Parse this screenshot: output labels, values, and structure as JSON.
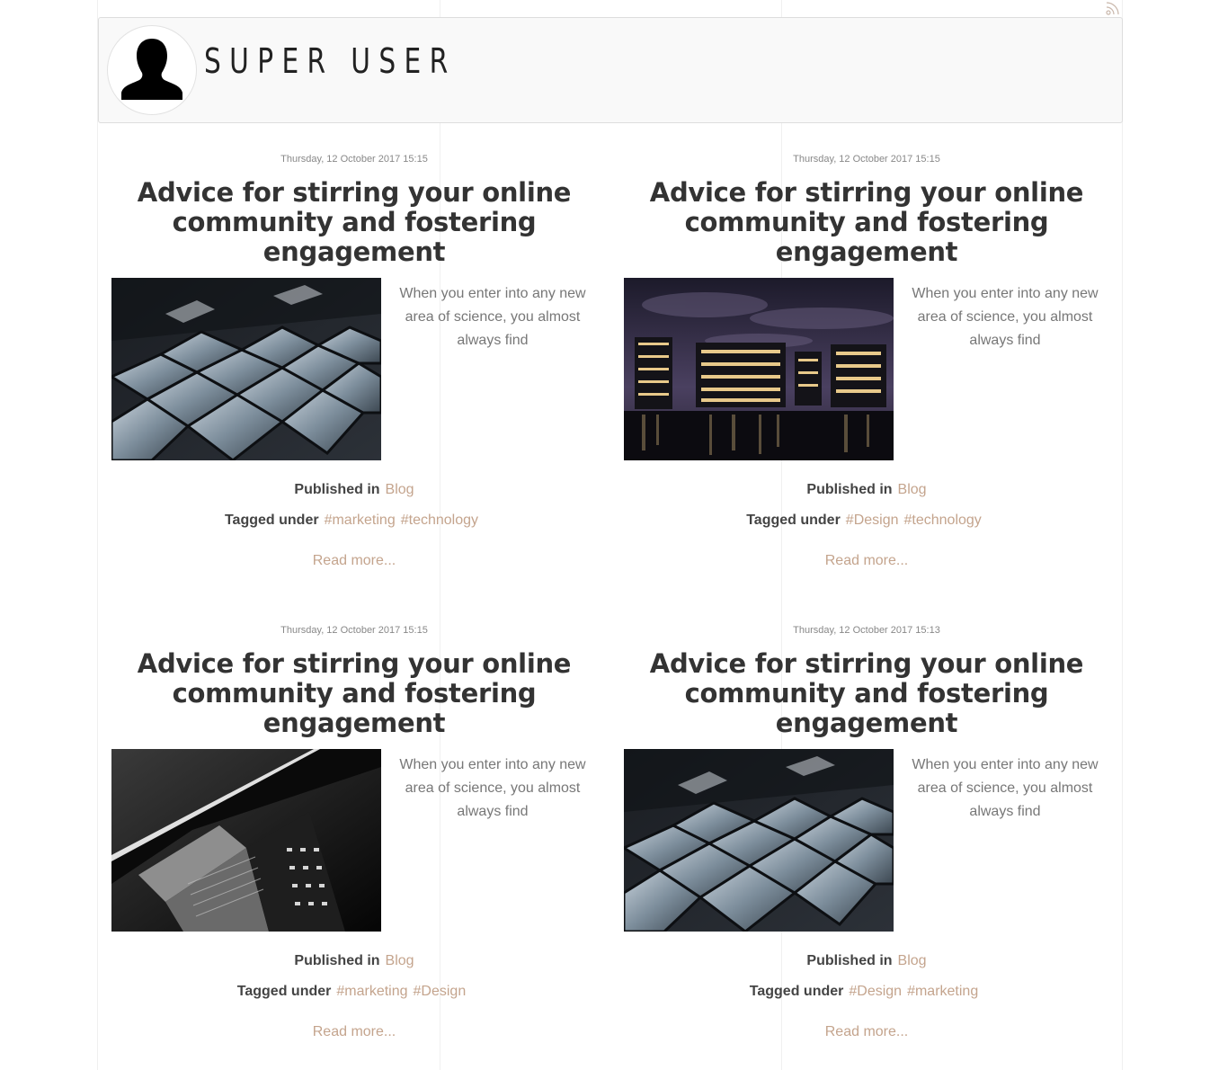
{
  "header": {
    "author_name": "SUPER USER",
    "rss_icon": "rss-icon",
    "avatar_icon": "user-silhouette-icon"
  },
  "colors": {
    "link": "#c4a48d",
    "title": "#333333",
    "box_bg": "#f9f9f9"
  },
  "articles": [
    {
      "date": "Thursday, 12 October 2017 15:15",
      "title": "Advice for stirring your online community and fostering engagement",
      "intro": "When you enter into any new area of science, you almost always find",
      "published_label": "Published in",
      "category": "Blog",
      "tagged_label": "Tagged under",
      "tags": [
        "#marketing",
        "#technology"
      ],
      "read_more": "Read more...",
      "image": "glass-cubes-image"
    },
    {
      "date": "Thursday, 12 October 2017 15:15",
      "title": "Advice for stirring your online community and fostering engagement",
      "intro": "When you enter into any new area of science, you almost always find",
      "published_label": "Published in",
      "category": "Blog",
      "tagged_label": "Tagged under",
      "tags": [
        "#Design",
        "#technology"
      ],
      "read_more": "Read more...",
      "image": "night-office-building-image"
    },
    {
      "date": "Thursday, 12 October 2017 15:15",
      "title": "Advice for stirring your online community and fostering engagement",
      "intro": "When you enter into any new area of science, you almost always find",
      "published_label": "Published in",
      "category": "Blog",
      "tagged_label": "Tagged under",
      "tags": [
        "#marketing",
        "#Design"
      ],
      "read_more": "Read more...",
      "image": "monochrome-skyscraper-image"
    },
    {
      "date": "Thursday, 12 October 2017 15:13",
      "title": "Advice for stirring your online community and fostering engagement",
      "intro": "When you enter into any new area of science, you almost always find",
      "published_label": "Published in",
      "category": "Blog",
      "tagged_label": "Tagged under",
      "tags": [
        "#Design",
        "#marketing"
      ],
      "read_more": "Read more...",
      "image": "glass-cubes-image"
    }
  ]
}
